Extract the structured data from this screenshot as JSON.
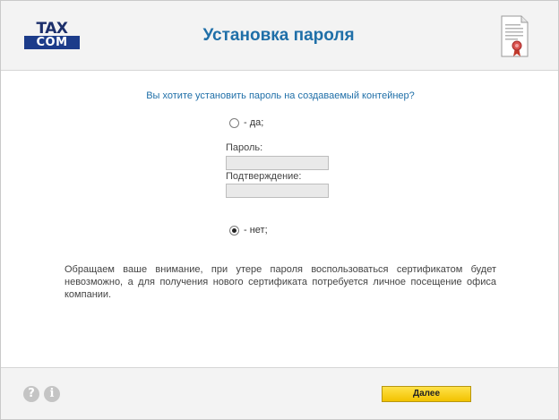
{
  "header": {
    "logo_top": "TAX",
    "logo_bottom": "COM",
    "title": "Установка пароля",
    "icon": "certificate-icon"
  },
  "main": {
    "question": "Вы хотите установить пароль на создаваемый контейнер?",
    "option_yes": {
      "label": "- да;",
      "selected": false
    },
    "password_label": "Пароль:",
    "password_value": "",
    "confirm_label": "Подтверждение:",
    "confirm_value": "",
    "option_no": {
      "label": "- нет;",
      "selected": true
    },
    "notice": "Обращаем ваше внимание, при утере пароля воспользоваться сертификатом будет невозможно, а для получения нового сертификата потребуется личное посещение офиса компании."
  },
  "footer": {
    "help_icon": "?",
    "info_icon": "i",
    "next_label": "Далее"
  },
  "colors": {
    "accent": "#1f6fa8",
    "logo_blue": "#1c3c8a",
    "button_yellow": "#f2c200"
  }
}
